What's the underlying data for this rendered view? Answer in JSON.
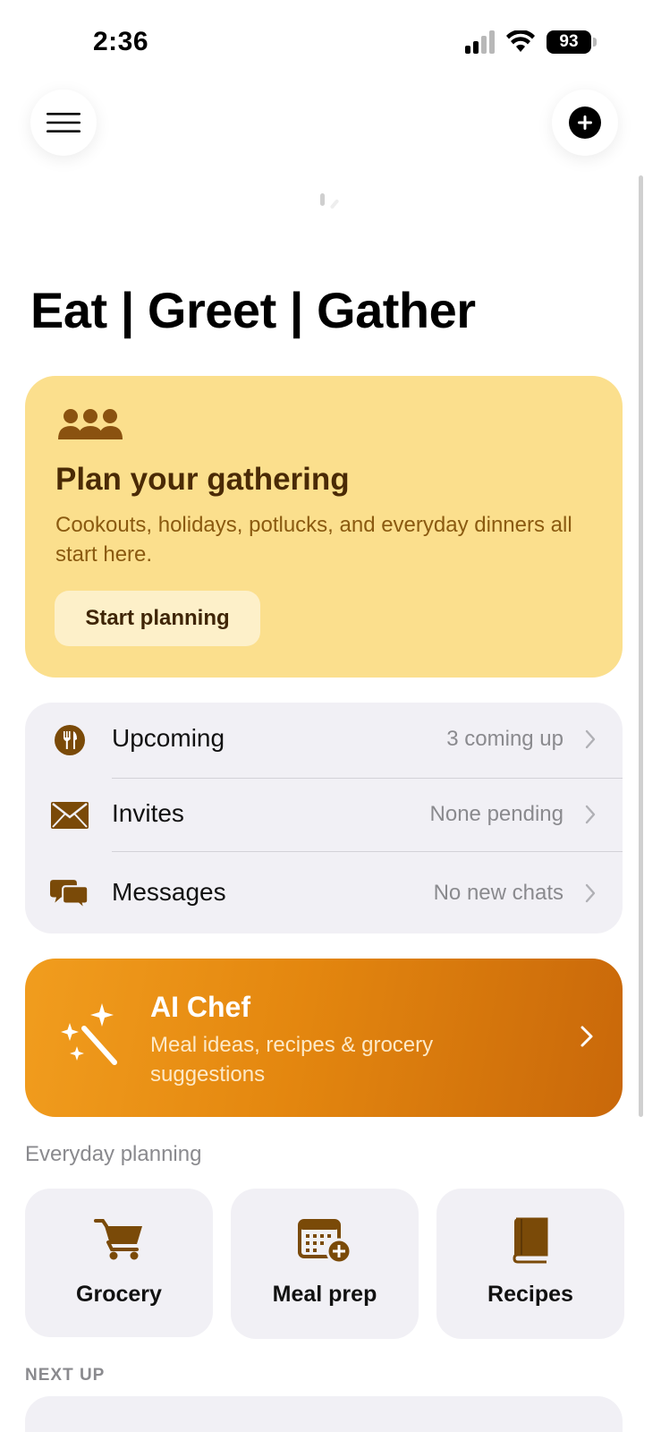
{
  "status_bar": {
    "time": "2:36",
    "battery": "93"
  },
  "header": {
    "title": "Eat | Greet | Gather"
  },
  "plan_card": {
    "title": "Plan your gathering",
    "description": "Cookouts, holidays, potlucks, and everyday dinners all start here.",
    "button_label": "Start planning"
  },
  "list": [
    {
      "label": "Upcoming",
      "value": "3 coming up",
      "icon": "fork-knife-icon"
    },
    {
      "label": "Invites",
      "value": "None pending",
      "icon": "envelope-icon"
    },
    {
      "label": "Messages",
      "value": "No new chats",
      "icon": "chat-bubbles-icon"
    }
  ],
  "ai_chef": {
    "title": "AI Chef",
    "description": "Meal ideas, recipes & grocery suggestions"
  },
  "everyday": {
    "label": "Everyday planning",
    "tiles": [
      {
        "label": "Grocery",
        "icon": "cart-icon"
      },
      {
        "label": "Meal prep",
        "icon": "calendar-plus-icon"
      },
      {
        "label": "Recipes",
        "icon": "book-icon"
      }
    ]
  },
  "next_up": {
    "label": "NEXT UP"
  },
  "colors": {
    "accent_brown": "#7a4a08",
    "plan_card_bg": "#fbdf8d",
    "ai_gradient_start": "#f19d1e",
    "ai_gradient_end": "#c9680a",
    "list_bg": "#f1f0f5"
  }
}
